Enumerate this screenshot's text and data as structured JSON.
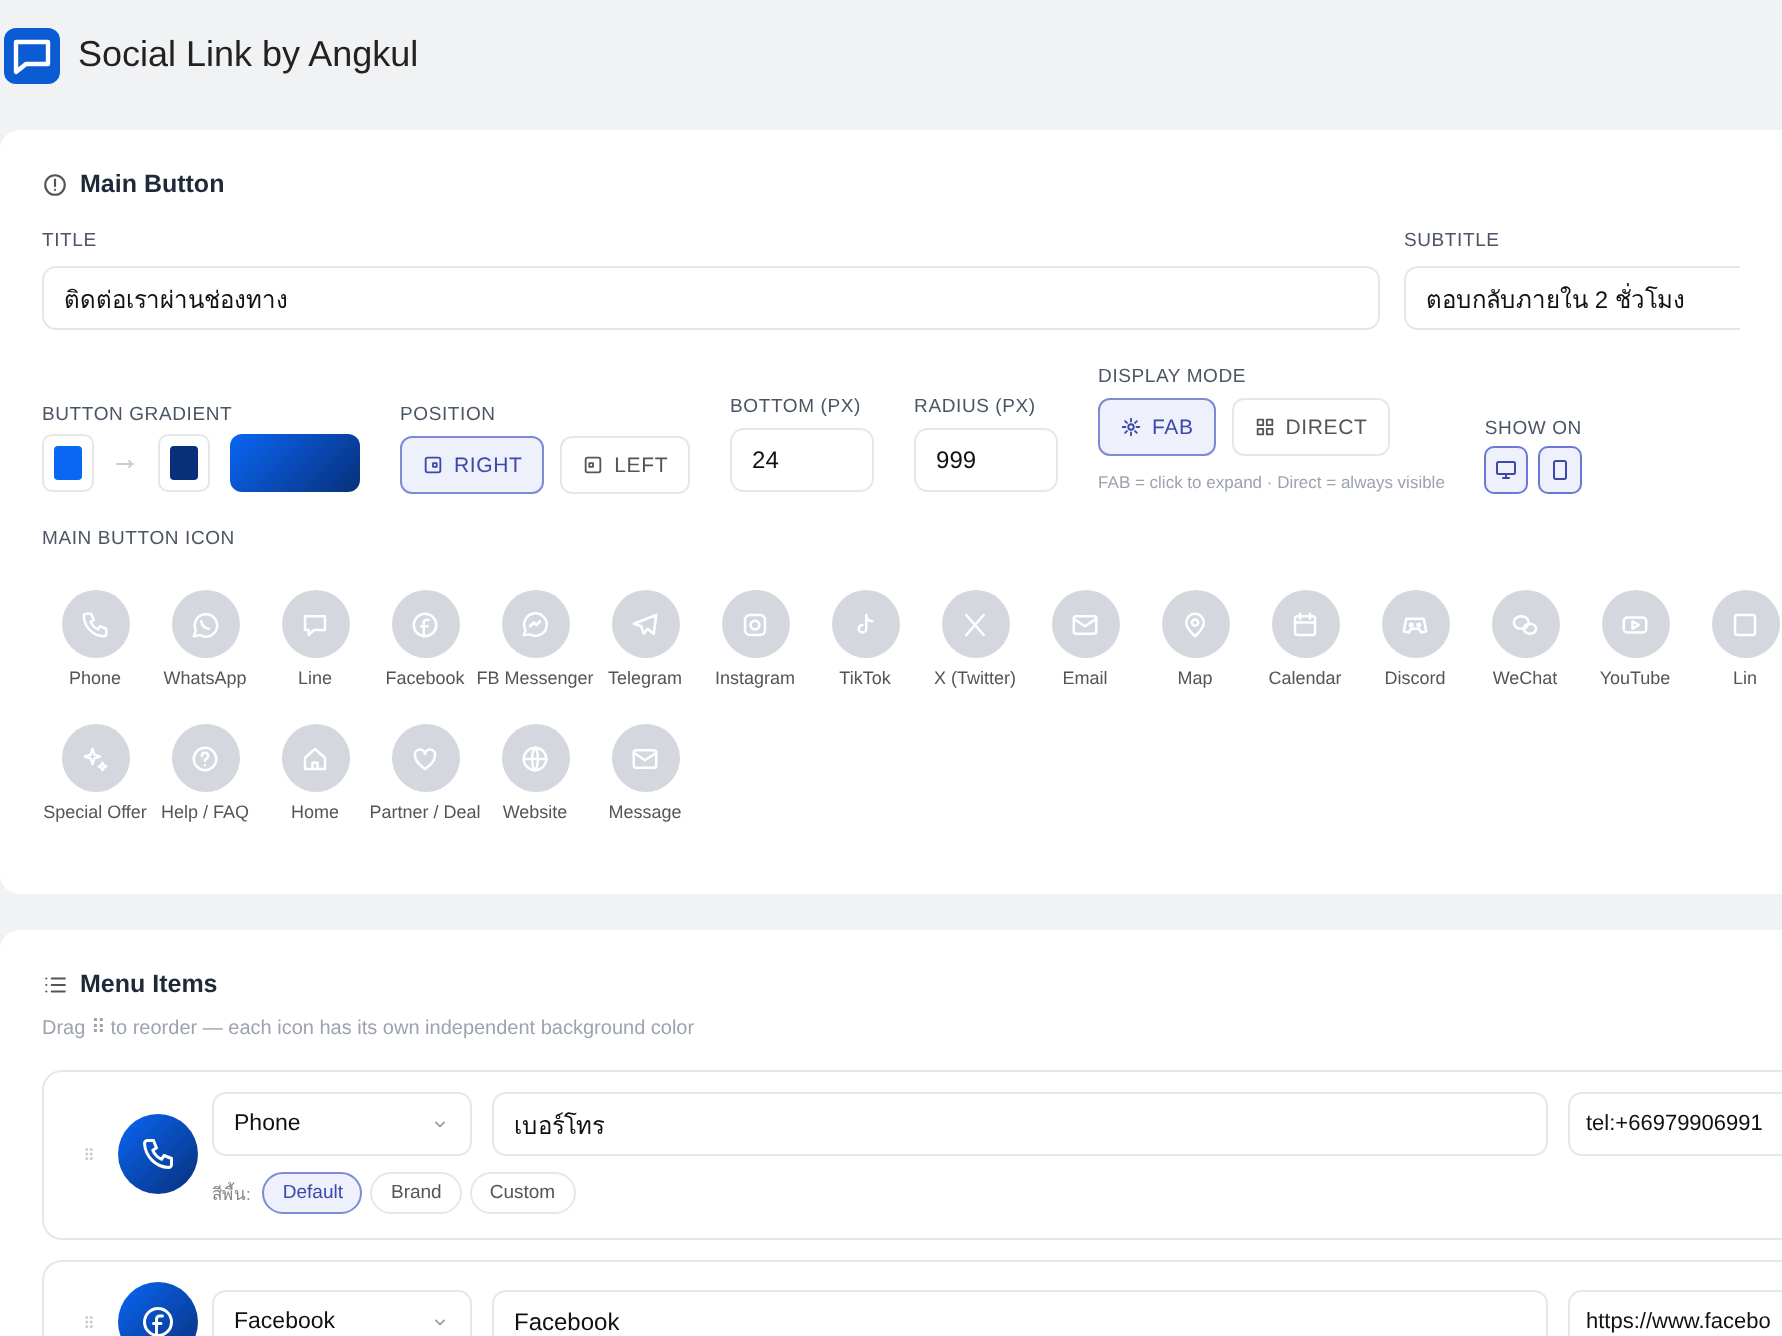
{
  "app": {
    "title": "Social Link by Angkul"
  },
  "main_button": {
    "heading": "Main Button",
    "title_field": {
      "label": "TITLE",
      "value": "ติดต่อเราผ่านช่องทาง"
    },
    "subtitle_field": {
      "label": "SUBTITLE",
      "value": "ตอบกลับภายใน 2 ชั่วโมง"
    },
    "gradient": {
      "label": "BUTTON GRADIENT",
      "stops": [
        {
          "color": "#0a66f5"
        },
        {
          "color": "#08307a"
        }
      ]
    },
    "position": {
      "label": "POSITION",
      "options": [
        {
          "label": "RIGHT",
          "selected": true
        },
        {
          "label": "LEFT",
          "selected": false
        }
      ]
    },
    "bottom": {
      "label": "BOTTOM (PX)",
      "value": "24"
    },
    "radius": {
      "label": "RADIUS (PX)",
      "value": "999"
    },
    "display_mode": {
      "label": "DISPLAY MODE",
      "options": [
        {
          "label": "FAB",
          "selected": true
        },
        {
          "label": "DIRECT",
          "selected": false
        }
      ],
      "hint": "FAB = click to expand · Direct = always visible"
    },
    "show_on": {
      "label": "SHOW ON",
      "options": [
        {
          "kind": "desktop",
          "on": true
        },
        {
          "kind": "mobile",
          "on": true
        }
      ]
    },
    "icon_label": "MAIN BUTTON ICON",
    "icons": [
      {
        "label": "Phone"
      },
      {
        "label": "WhatsApp"
      },
      {
        "label": "Line"
      },
      {
        "label": "Facebook"
      },
      {
        "label": "FB Messenger"
      },
      {
        "label": "Telegram"
      },
      {
        "label": "Instagram"
      },
      {
        "label": "TikTok"
      },
      {
        "label": "X (Twitter)"
      },
      {
        "label": "Email"
      },
      {
        "label": "Map"
      },
      {
        "label": "Calendar"
      },
      {
        "label": "Discord"
      },
      {
        "label": "WeChat"
      },
      {
        "label": "YouTube"
      },
      {
        "label": "Lin"
      },
      {
        "label": "Special Offer"
      },
      {
        "label": "Help / FAQ"
      },
      {
        "label": "Home"
      },
      {
        "label": "Partner / Deal"
      },
      {
        "label": "Website"
      },
      {
        "label": "Message"
      }
    ]
  },
  "menu_items": {
    "heading": "Menu Items",
    "hint": "Drag ⠿ to reorder — each icon has its own independent background color",
    "items": [
      {
        "kind": "phone",
        "type": "Phone",
        "label": "เบอร์โทร",
        "url": "tel:+66979906991",
        "color_label": "สีพื้น:",
        "color_options": [
          {
            "label": "Default",
            "selected": true
          },
          {
            "label": "Brand",
            "selected": false
          },
          {
            "label": "Custom",
            "selected": false
          }
        ]
      },
      {
        "kind": "facebook",
        "type": "Facebook",
        "label": "Facebook",
        "url": "https://www.facebo"
      }
    ]
  }
}
